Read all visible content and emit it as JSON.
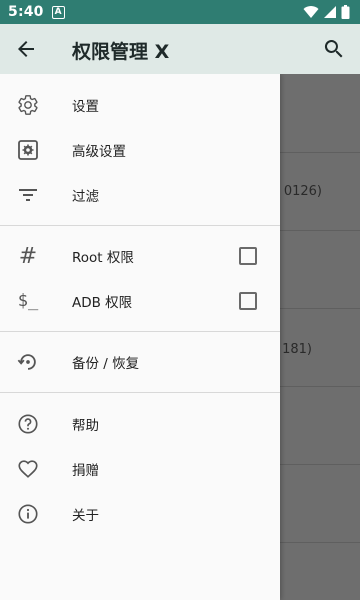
{
  "status_bar": {
    "time": "5:40",
    "notification_icon": "A"
  },
  "appbar": {
    "title": "权限管理 X",
    "back_icon": "arrow-back-icon",
    "search_icon": "search-icon"
  },
  "drawer": {
    "group1": [
      {
        "label": "设置",
        "icon": "gear-icon"
      },
      {
        "label": "高级设置",
        "icon": "advanced-settings-icon"
      },
      {
        "label": "过滤",
        "icon": "filter-icon"
      }
    ],
    "group2": [
      {
        "label": "Root 权限",
        "icon": "hash-icon",
        "checked": false
      },
      {
        "label": "ADB 权限",
        "icon": "shell-icon",
        "checked": false
      }
    ],
    "group3": [
      {
        "label": "备份 / 恢复",
        "icon": "backup-restore-icon"
      }
    ],
    "group4": [
      {
        "label": "帮助",
        "icon": "help-icon"
      },
      {
        "label": "捐赠",
        "icon": "heart-icon"
      },
      {
        "label": "关于",
        "icon": "info-icon"
      }
    ]
  },
  "background": {
    "partial_text_1": "0126)",
    "partial_text_2": "181)"
  }
}
